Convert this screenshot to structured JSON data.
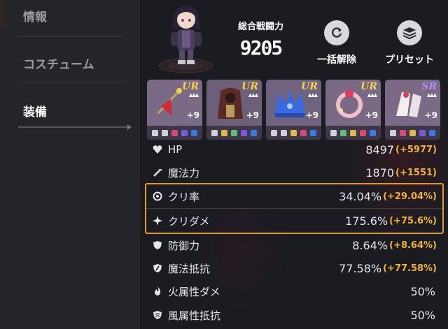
{
  "sidebar": {
    "items": [
      {
        "label": "情報"
      },
      {
        "label": "コスチューム"
      },
      {
        "label": "装備"
      }
    ],
    "active_index": 2
  },
  "header": {
    "power_label": "総合戦闘力",
    "power_value": "9205",
    "buttons": [
      {
        "label": "一括解除",
        "icon": "refresh-icon"
      },
      {
        "label": "プリセット",
        "icon": "layers-icon"
      }
    ]
  },
  "equipment": [
    {
      "rarity": "UR",
      "level": "+9",
      "art": "crimson-staff",
      "rarity_color": "#f4d24a",
      "bg": "#7a6a86"
    },
    {
      "rarity": "UR",
      "level": "+9",
      "art": "dark-robe",
      "rarity_color": "#f4d24a",
      "bg": "#6d5f77"
    },
    {
      "rarity": "UR",
      "level": "+9",
      "art": "blue-crown",
      "rarity_color": "#f4d24a",
      "bg": "#6f6380"
    },
    {
      "rarity": "UR",
      "level": "+9",
      "art": "rose-ring",
      "rarity_color": "#f4d24a",
      "bg": "#7a6a86"
    },
    {
      "rarity": "SR",
      "level": "+9",
      "art": "white-gloves",
      "rarity_color": "#b58af2",
      "bg": "#7a6a86"
    }
  ],
  "stats": [
    {
      "name": "HP",
      "value": "8497",
      "bonus": "(+5977)",
      "icon": "heart-icon"
    },
    {
      "name": "魔法力",
      "value": "1870",
      "bonus": "(+1551)",
      "icon": "wand-icon"
    },
    {
      "name": "クリ率",
      "value": "34.04%",
      "bonus": "(+29.04%)",
      "icon": "crit-rate-icon"
    },
    {
      "name": "クリダメ",
      "value": "175.6%",
      "bonus": "(+75.6%)",
      "icon": "crit-damage-icon"
    },
    {
      "name": "防御力",
      "value": "8.64%",
      "bonus": "(+8.64%)",
      "icon": "shield-icon"
    },
    {
      "name": "魔法抵抗",
      "value": "77.58%",
      "bonus": "(+77.58%)",
      "icon": "magic-shield-icon"
    },
    {
      "name": "火属性ダメ",
      "value": "50%",
      "bonus": "",
      "icon": "fire-icon"
    },
    {
      "name": "風属性抵抗",
      "value": "50%",
      "bonus": "",
      "icon": "wind-shield-icon"
    }
  ],
  "colors": {
    "accent": "#f0b13d",
    "highlight_border": "#e39a2c"
  }
}
